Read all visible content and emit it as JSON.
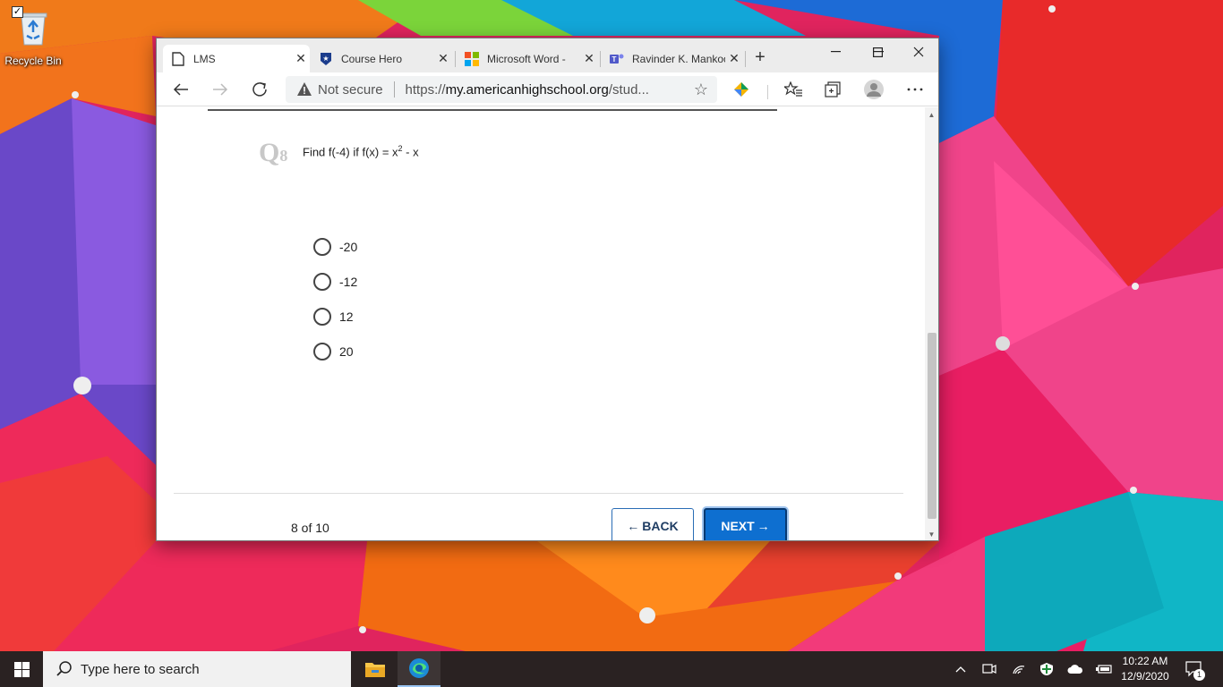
{
  "desktop": {
    "recycle_bin_label": "Recycle Bin"
  },
  "browser": {
    "tabs": [
      {
        "title": "LMS",
        "icon": "page-icon",
        "active": true
      },
      {
        "title": "Course Hero",
        "icon": "course-hero-icon",
        "active": false
      },
      {
        "title": "Microsoft Word -",
        "icon": "microsoft-icon",
        "active": false
      },
      {
        "title": "Ravinder K. Mankoo",
        "icon": "teams-icon",
        "active": false
      }
    ],
    "address": {
      "security_label": "Not secure",
      "url_prefix": "https://",
      "url_host": "my.americanhighschool.org",
      "url_path": "/stud..."
    }
  },
  "quiz": {
    "question_label": "Q",
    "question_number": "8",
    "question_text_main": "Find f(-4) if f(x) = x",
    "question_text_exp": "2",
    "question_text_tail": " - x",
    "options": [
      "-20",
      "-12",
      "12",
      "20"
    ],
    "progress_text": "8 of 10",
    "back_label": "BACK",
    "next_label": "NEXT"
  },
  "taskbar": {
    "search_placeholder": "Type here to search",
    "time": "10:22 AM",
    "date": "12/9/2020",
    "notification_count": "1"
  },
  "colors": {
    "accent_blue": "#0e6fd0",
    "question_number_gray": "#c8c8c8"
  }
}
